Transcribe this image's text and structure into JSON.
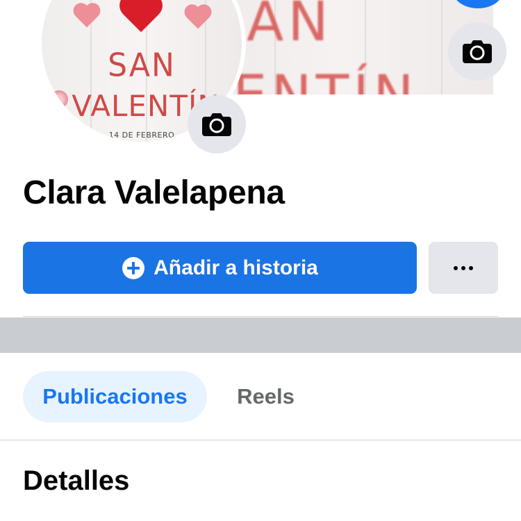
{
  "cover": {
    "text_line1": "AN",
    "text_line2": "ENTÍN"
  },
  "avatar": {
    "title_line1": "SAN",
    "title_line2": "VALENTÍN",
    "date": "14 DE FEBRERO"
  },
  "profile": {
    "name": "Clara Valelapena"
  },
  "actions": {
    "add_story_label": "Añadir a historia"
  },
  "tabs": [
    {
      "label": "Publicaciones",
      "active": true
    },
    {
      "label": "Reels",
      "active": false
    }
  ],
  "sections": {
    "details_title": "Detalles"
  },
  "colors": {
    "primary": "#1b74e4",
    "active_tab_bg": "#e7f3ff",
    "active_tab_text": "#1877f2",
    "secondary_button_bg": "#e4e6eb",
    "band_gray": "#c9ccd1"
  }
}
